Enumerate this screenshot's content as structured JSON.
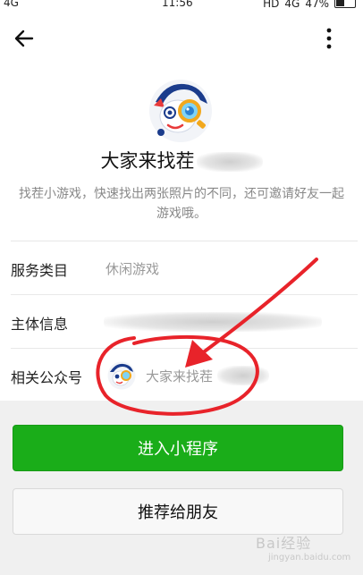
{
  "status_bar": {
    "network_left": "4G",
    "time": "11:56",
    "hd": "HD",
    "network_right": "4G",
    "battery": "47%"
  },
  "app": {
    "name_visible": "大家来找茬",
    "description": "找茬小游戏，快速找出两张照片的不同，还可邀请好友一起游戏哦。"
  },
  "info_rows": [
    {
      "label": "服务类目",
      "value": "休闲游戏"
    },
    {
      "label": "主体信息",
      "value": ""
    },
    {
      "label": "相关公众号",
      "value": "大家来找茬"
    }
  ],
  "buttons": {
    "enter": "进入小程序",
    "recommend": "推荐给朋友"
  },
  "watermark": {
    "text": "Bai经验",
    "sub": "jingyan.baidu.com"
  },
  "colors": {
    "primary_green": "#1aad19",
    "annotation_red": "#e8232a"
  },
  "icons": {
    "back": "back-arrow-icon",
    "more": "more-vertical-icon"
  }
}
